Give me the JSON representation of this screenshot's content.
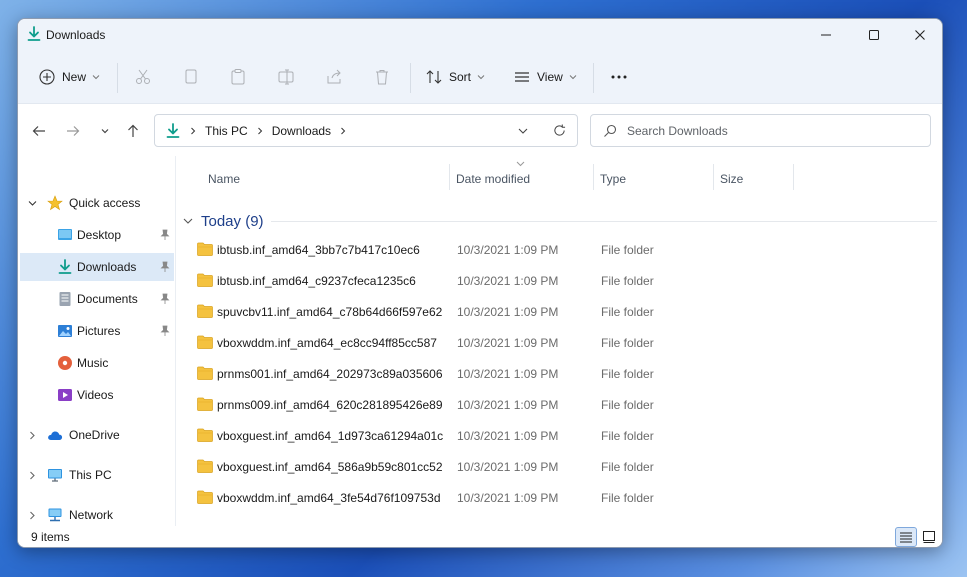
{
  "window": {
    "title": "Downloads"
  },
  "toolbar": {
    "new_label": "New",
    "sort_label": "Sort",
    "view_label": "View"
  },
  "address": {
    "crumbs": [
      "This PC",
      "Downloads"
    ]
  },
  "search": {
    "placeholder": "Search Downloads"
  },
  "sidebar": {
    "items": [
      {
        "label": "Quick access",
        "icon": "star-icon"
      },
      {
        "label": "Desktop",
        "icon": "desktop-icon",
        "pinned": true
      },
      {
        "label": "Downloads",
        "icon": "download-icon",
        "pinned": true,
        "selected": true
      },
      {
        "label": "Documents",
        "icon": "documents-icon",
        "pinned": true
      },
      {
        "label": "Pictures",
        "icon": "pictures-icon",
        "pinned": true
      },
      {
        "label": "Music",
        "icon": "music-icon"
      },
      {
        "label": "Videos",
        "icon": "videos-icon"
      },
      {
        "label": "OneDrive",
        "icon": "cloud-icon"
      },
      {
        "label": "This PC",
        "icon": "computer-icon"
      },
      {
        "label": "Network",
        "icon": "network-icon"
      }
    ]
  },
  "columns": {
    "name": "Name",
    "date": "Date modified",
    "type": "Type",
    "size": "Size"
  },
  "group": {
    "label": "Today (9)"
  },
  "files": [
    {
      "name": "ibtusb.inf_amd64_3bb7c7b417c10ec6",
      "date": "10/3/2021 1:09 PM",
      "type": "File folder"
    },
    {
      "name": "ibtusb.inf_amd64_c9237cfeca1235c6",
      "date": "10/3/2021 1:09 PM",
      "type": "File folder"
    },
    {
      "name": "spuvcbv11.inf_amd64_c78b64d66f597e62",
      "date": "10/3/2021 1:09 PM",
      "type": "File folder"
    },
    {
      "name": "vboxwddm.inf_amd64_ec8cc94ff85cc587",
      "date": "10/3/2021 1:09 PM",
      "type": "File folder"
    },
    {
      "name": "prnms001.inf_amd64_202973c89a035606",
      "date": "10/3/2021 1:09 PM",
      "type": "File folder"
    },
    {
      "name": "prnms009.inf_amd64_620c281895426e89",
      "date": "10/3/2021 1:09 PM",
      "type": "File folder"
    },
    {
      "name": "vboxguest.inf_amd64_1d973ca61294a01c",
      "date": "10/3/2021 1:09 PM",
      "type": "File folder"
    },
    {
      "name": "vboxguest.inf_amd64_586a9b59c801cc52",
      "date": "10/3/2021 1:09 PM",
      "type": "File folder"
    },
    {
      "name": "vboxwddm.inf_amd64_3fe54d76f109753d",
      "date": "10/3/2021 1:09 PM",
      "type": "File folder"
    }
  ],
  "status": {
    "count": "9 items"
  },
  "colors": {
    "accent": "#0f9d8c",
    "folder": "#f4c23f",
    "selection": "#dce9f7",
    "group": "#1e3f8a"
  }
}
